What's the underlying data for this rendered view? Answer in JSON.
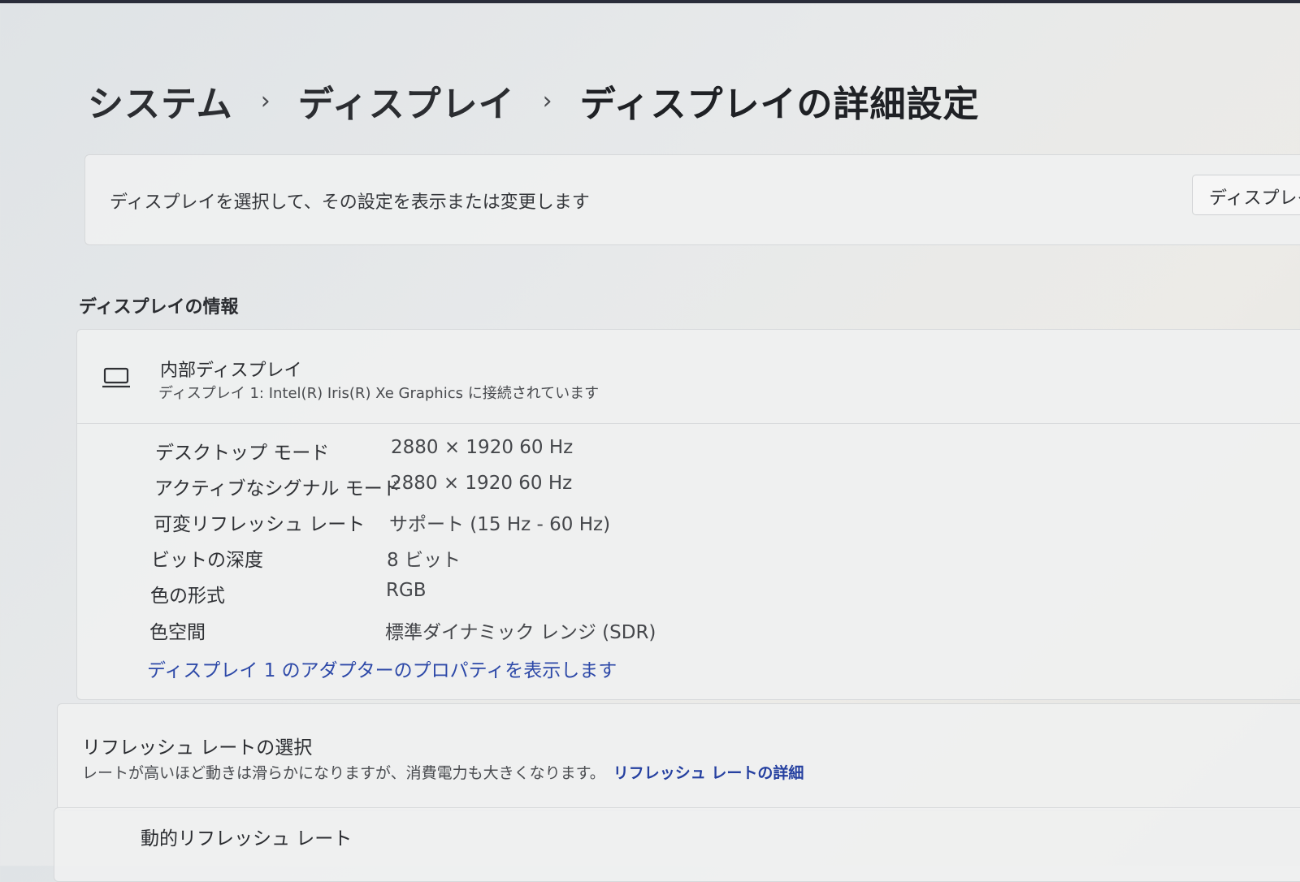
{
  "breadcrumb": {
    "items": [
      "システム",
      "ディスプレイ",
      "ディスプレイの詳細設定"
    ],
    "separator": "›"
  },
  "select_display": {
    "description": "ディスプレイを選択して、その設定を表示または変更します",
    "button_label": "ディスプレイ"
  },
  "display_info": {
    "heading": "ディスプレイの情報",
    "icon": "laptop-icon",
    "name": "内部ディスプレイ",
    "subtitle": "ディスプレイ 1: Intel(R) Iris(R) Xe Graphics に接続されています",
    "specs": [
      {
        "label": "デスクトップ モード",
        "value": "2880 × 1920 60 Hz"
      },
      {
        "label": "アクティブなシグナル モード",
        "value": "2880 × 1920 60 Hz"
      },
      {
        "label": "可変リフレッシュ レート",
        "value": "サポート (15 Hz - 60 Hz)"
      },
      {
        "label": "ビットの深度",
        "value": "8 ビット"
      },
      {
        "label": "色の形式",
        "value": "RGB"
      },
      {
        "label": "色空間",
        "value": "標準ダイナミック レンジ (SDR)"
      }
    ],
    "adapter_link": "ディスプレイ 1 のアダプターのプロパティを表示します"
  },
  "refresh_rate": {
    "title": "リフレッシュ レートの選択",
    "description": "レートが高いほど動きは滑らかになりますが、消費電力も大きくなります。",
    "link": "リフレッシュ レートの詳細"
  },
  "dynamic_refresh": {
    "label": "動的リフレッシュ レート"
  },
  "colors": {
    "link": "#2d49a8",
    "text": "#2b2d31"
  }
}
